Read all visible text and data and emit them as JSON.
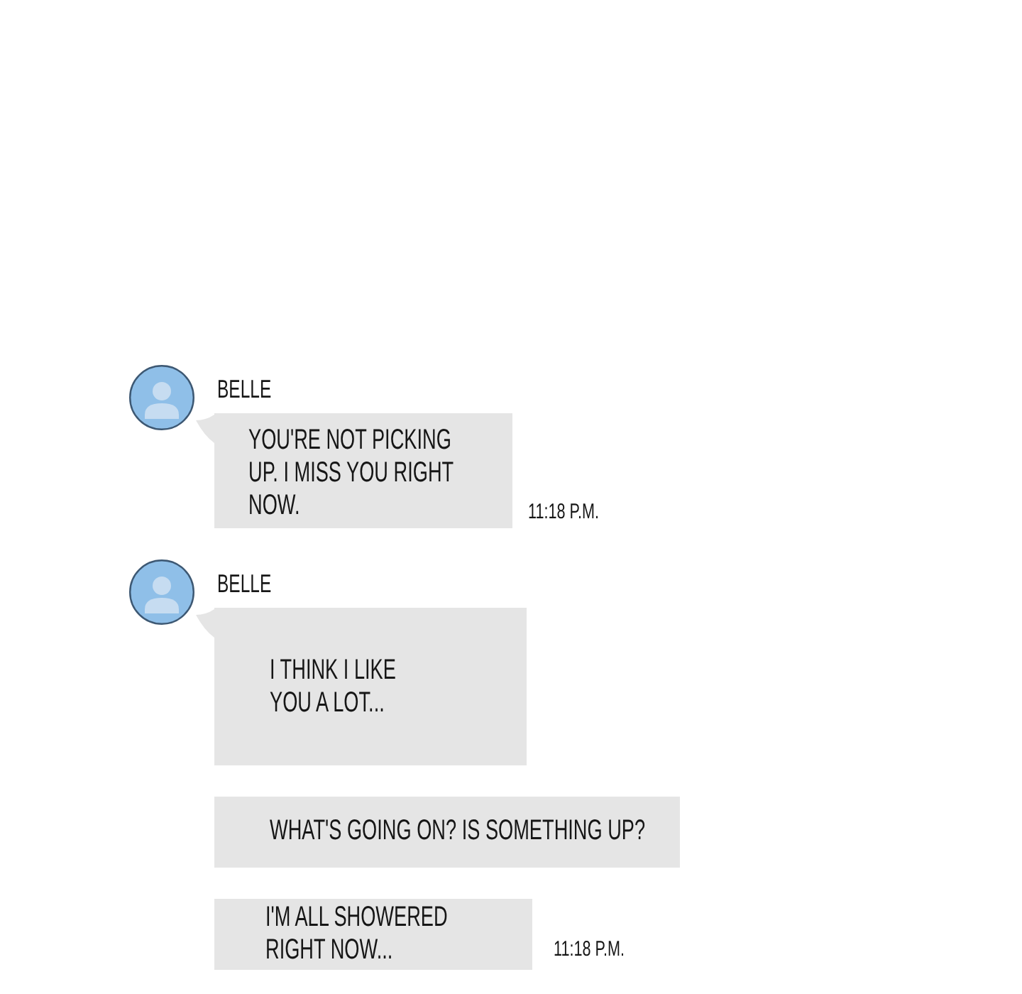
{
  "messages": [
    {
      "sender": "BELLE",
      "lines": [
        "YOU'RE NOT PICKING",
        "UP. I MISS YOU RIGHT",
        "NOW."
      ],
      "time": "11:18 P.M."
    },
    {
      "sender": "BELLE",
      "lines": [
        "I THINK I LIKE",
        "YOU A LOT..."
      ]
    },
    {
      "lines": [
        "WHAT'S GOING ON? IS SOMETHING UP?"
      ]
    },
    {
      "lines": [
        "I'M ALL SHOWERED",
        "RIGHT NOW..."
      ],
      "time": "11:18 P.M."
    }
  ]
}
